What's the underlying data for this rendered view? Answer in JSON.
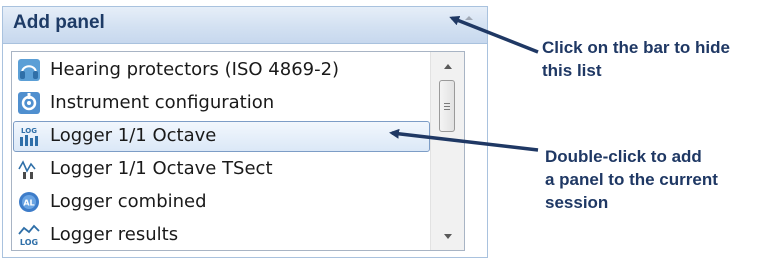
{
  "panel": {
    "title": "Add panel",
    "items": [
      {
        "label": "Hearing protectors (ISO 4869-2)",
        "icon": "hearing-protector-icon"
      },
      {
        "label": "Instrument configuration",
        "icon": "instrument-configuration-icon"
      },
      {
        "label": "Logger 1/1 Octave",
        "icon": "logger-octave-icon",
        "selected": true
      },
      {
        "label": "Logger 1/1 Octave TSect",
        "icon": "logger-octave-tsect-icon"
      },
      {
        "label": "Logger combined",
        "icon": "logger-combined-icon"
      },
      {
        "label": "Logger results",
        "icon": "logger-results-icon"
      }
    ]
  },
  "annotations": {
    "hide_list": {
      "line1": "Click on the bar to hide",
      "line2": "this list"
    },
    "add_panel": {
      "line1": "Double-click to add",
      "line2": "a panel to the current",
      "line3": "session"
    }
  },
  "colors": {
    "annotation_text": "#1f3864",
    "arrow": "#1f3864",
    "header_text": "#1e3b66",
    "selected_border": "#7d9dc6"
  }
}
